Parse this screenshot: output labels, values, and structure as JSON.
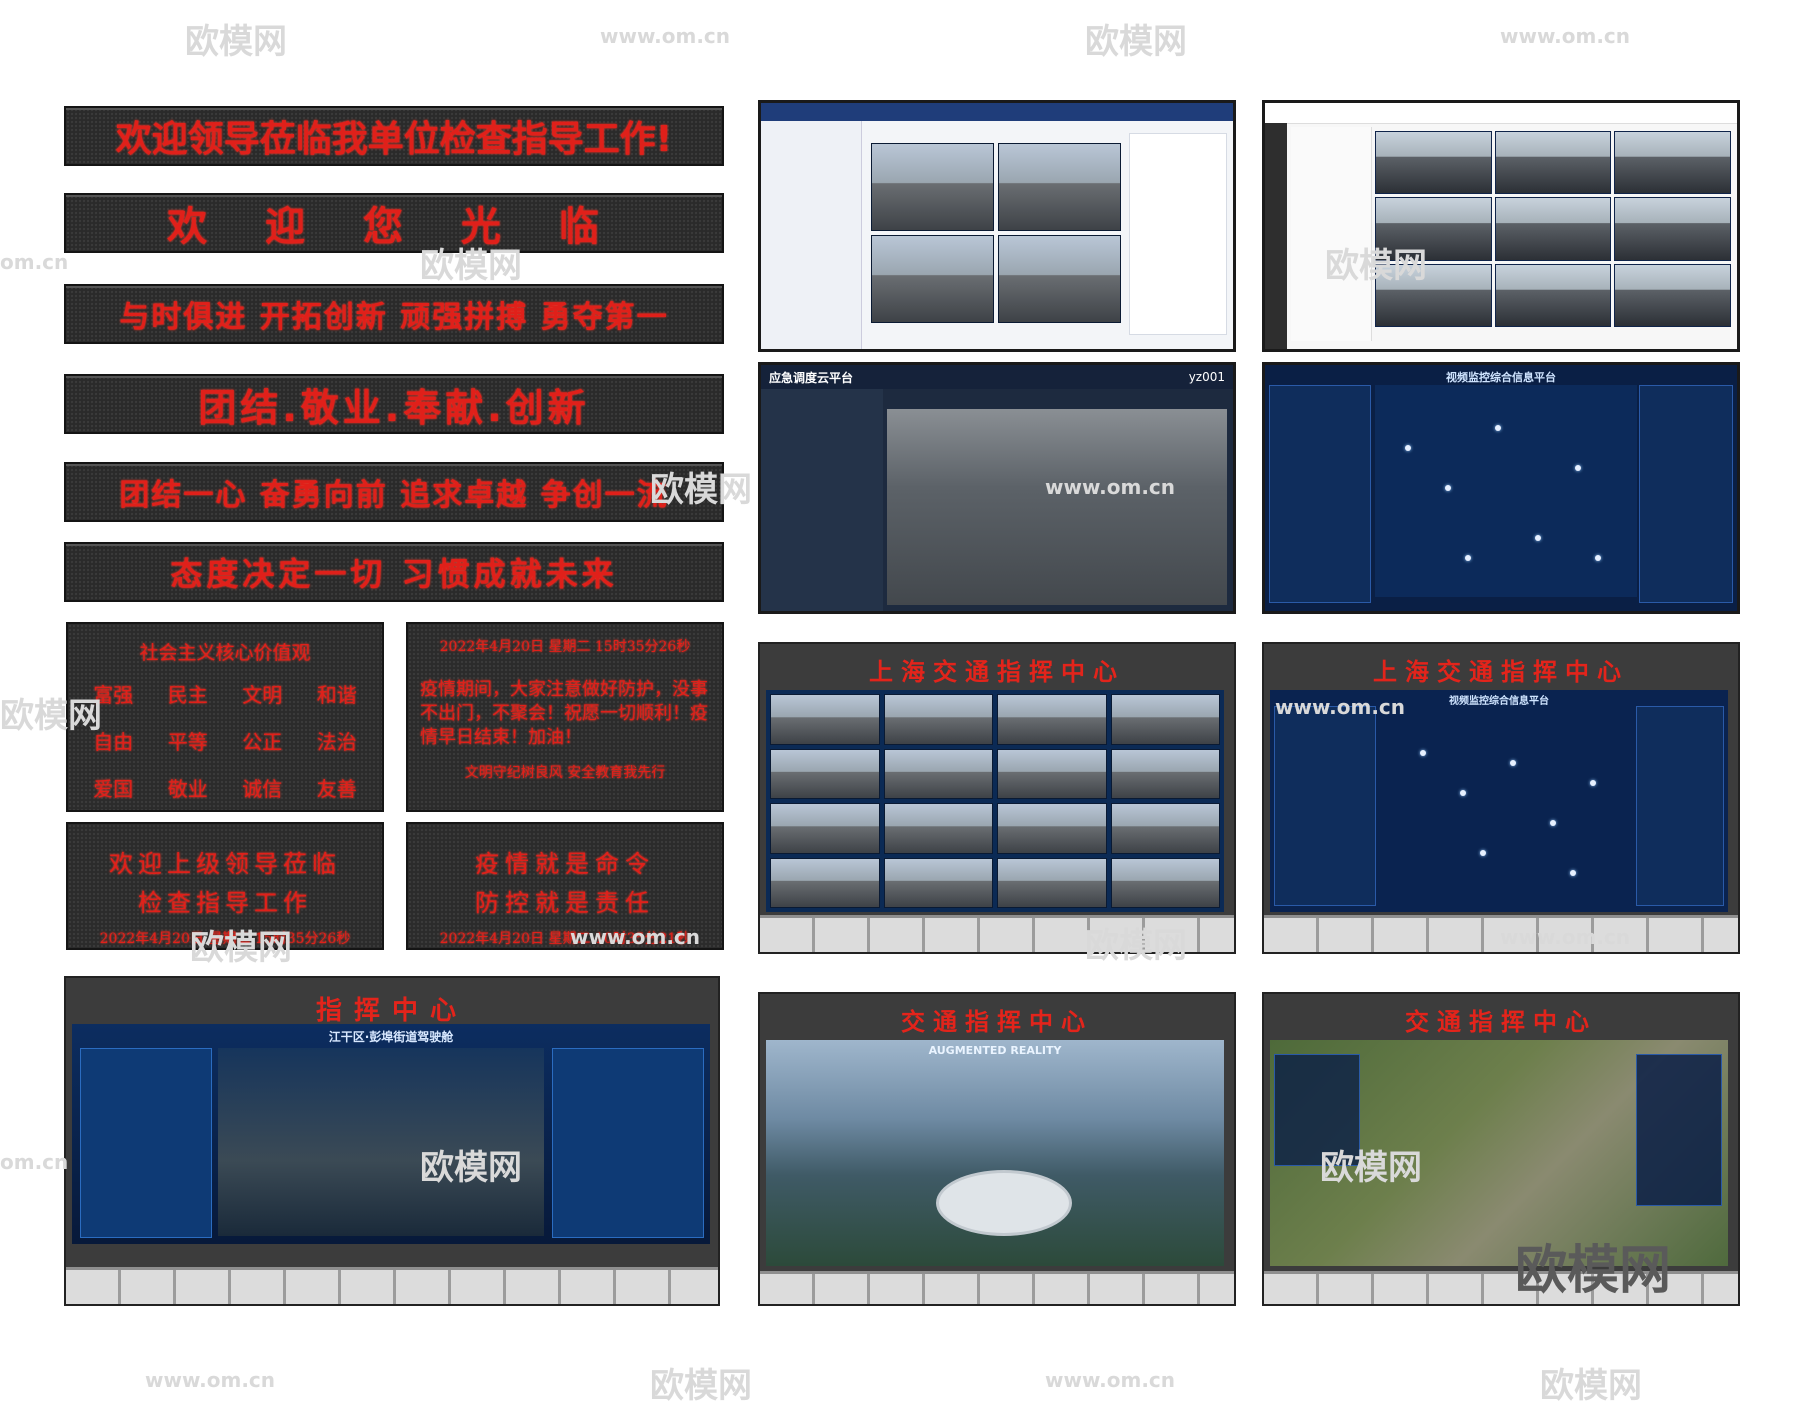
{
  "signs": [
    "欢迎领导莅临我单位检查指导工作!",
    "欢 迎 您 光 临",
    "与时俱进 开拓创新 顽强拼搏 勇夺第一",
    "团结.敬业.奉献.创新",
    "团结一心 奋勇向前 追求卓越 争创一流",
    "态度决定一切 习惯成就未来"
  ],
  "values_panel": {
    "title": "社会主义核心价值观",
    "items": [
      "富强",
      "民主",
      "文明",
      "和谐",
      "自由",
      "平等",
      "公正",
      "法治",
      "爱国",
      "敬业",
      "诚信",
      "友善"
    ]
  },
  "notice_panel": {
    "datetime": "2022年4月20日 星期二 15时35分26秒",
    "text": "疫情期间，大家注意做好防护，没事不出门，不聚会！祝愿一切顺利！疫情早日结束！加油！",
    "footer": "文明守纪树良风 安全教育我先行"
  },
  "welcome_panel": {
    "line1": "欢迎上级领导莅临",
    "line2": "检查指导工作",
    "datetime": "2022年4月20日 星期二 15时35分26秒"
  },
  "epidemic_panel": {
    "line1": "疫情就是命令",
    "line2": "防控就是责任",
    "datetime": "2022年4月20日 星期二 10时35分21秒"
  },
  "screens": {
    "emergency_title": "应急调度云平台",
    "emergency_user": "yz001",
    "map_title": "视频监控综合信息平台",
    "wall1_title": "上海交通指挥中心",
    "wall2_title": "上海交通指挥中心",
    "wall2_sub": "视频监控综合信息平台",
    "wall3_title": "指挥中心",
    "wall3_sub": "江干区·彭埠街道驾驶舱",
    "wall4_title": "交通指挥中心",
    "wall4_sub": "AUGMENTED REALITY",
    "wall5_title": "交通指挥中心"
  },
  "watermarks": {
    "logo": "欧模网",
    "url": "www.om.cn",
    "url_short": "om.cn"
  },
  "colors": {
    "led_red": "#e0201a",
    "screen_blue": "#0b2a55"
  }
}
